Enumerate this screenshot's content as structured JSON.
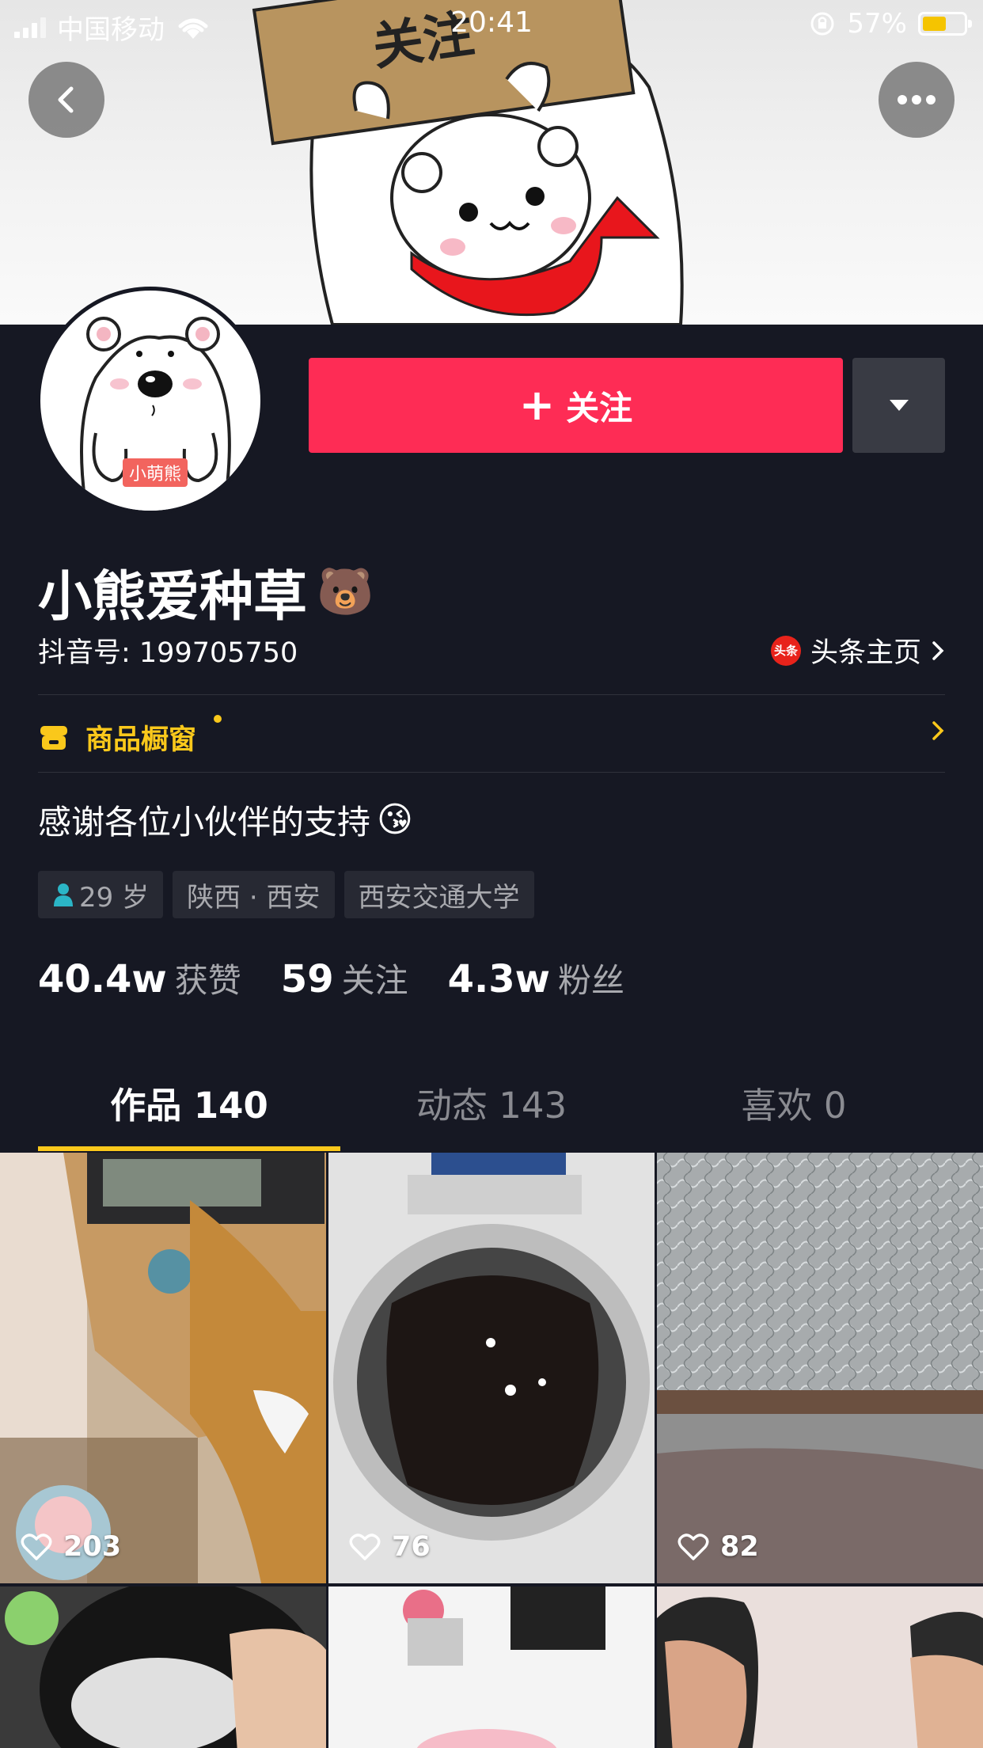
{
  "status_bar": {
    "carrier": "中国移动",
    "time": "20:41",
    "battery": "57%",
    "battery_level": 0.57
  },
  "banner": {
    "sign_text": "关注"
  },
  "avatar": {
    "tag": "小萌熊"
  },
  "actions": {
    "follow_label": "关注",
    "plus": "+"
  },
  "profile": {
    "nickname": "小熊爱种草",
    "nickname_emoji": "🐻",
    "douyin_id": "抖音号: 199705750",
    "toutiao_label": "头条主页",
    "toutiao_logo": "头条",
    "shop_label": "商品橱窗",
    "bio": "感谢各位小伙伴的支持",
    "bio_emoji": "😘",
    "tags": [
      "29 岁",
      "陕西 · 西安",
      "西安交通大学"
    ]
  },
  "stats": [
    {
      "num": "40.4w",
      "label": "获赞"
    },
    {
      "num": "59",
      "label": "关注"
    },
    {
      "num": "4.3w",
      "label": "粉丝"
    }
  ],
  "tabs": [
    {
      "label": "作品 140"
    },
    {
      "label": "动态 143"
    },
    {
      "label": "喜欢 0"
    }
  ],
  "videos": [
    {
      "likes": "203"
    },
    {
      "likes": "76"
    },
    {
      "likes": "82"
    }
  ],
  "colors": {
    "background": "#161823",
    "follow": "#fe2c55",
    "accent": "#fac81b"
  }
}
